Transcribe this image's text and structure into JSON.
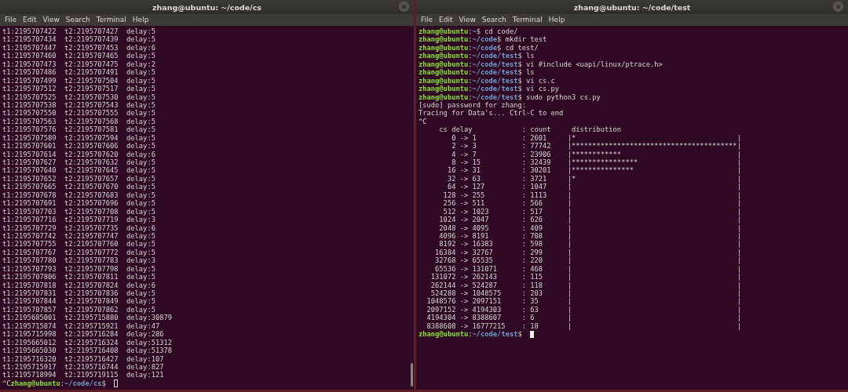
{
  "windows": [
    {
      "title": "zhang@ubuntu: ~/code/cs",
      "focused": false,
      "menu": [
        "File",
        "Edit",
        "View",
        "Search",
        "Terminal",
        "Help"
      ],
      "lines": [
        {
          "kind": "output",
          "text": "t1:2195707422  t2:2195707427  delay:5"
        },
        {
          "kind": "output",
          "text": "t1:2195707434  t2:2195707439  delay:5"
        },
        {
          "kind": "output",
          "text": "t1:2195707447  t2:2195707453  delay:6"
        },
        {
          "kind": "output",
          "text": "t1:2195707460  t2:2195707465  delay:5"
        },
        {
          "kind": "output",
          "text": "t1:2195707473  t2:2195707475  delay:2"
        },
        {
          "kind": "output",
          "text": "t1:2195707486  t2:2195707491  delay:5"
        },
        {
          "kind": "output",
          "text": "t1:2195707499  t2:2195707504  delay:5"
        },
        {
          "kind": "output",
          "text": "t1:2195707512  t2:2195707517  delay:5"
        },
        {
          "kind": "output",
          "text": "t1:2195707525  t2:2195707530  delay:5"
        },
        {
          "kind": "output",
          "text": "t1:2195707538  t2:2195707543  delay:5"
        },
        {
          "kind": "output",
          "text": "t1:2195707550  t2:2195707555  delay:5"
        },
        {
          "kind": "output",
          "text": "t1:2195707563  t2:2195707568  delay:5"
        },
        {
          "kind": "output",
          "text": "t1:2195707576  t2:2195707581  delay:5"
        },
        {
          "kind": "output",
          "text": "t1:2195707589  t2:2195707594  delay:5"
        },
        {
          "kind": "output",
          "text": "t1:2195707601  t2:2195707606  delay:5"
        },
        {
          "kind": "output",
          "text": "t1:2195707614  t2:2195707620  delay:6"
        },
        {
          "kind": "output",
          "text": "t1:2195707627  t2:2195707632  delay:5"
        },
        {
          "kind": "output",
          "text": "t1:2195707640  t2:2195707645  delay:5"
        },
        {
          "kind": "output",
          "text": "t1:2195707652  t2:2195707657  delay:5"
        },
        {
          "kind": "output",
          "text": "t1:2195707665  t2:2195707670  delay:5"
        },
        {
          "kind": "output",
          "text": "t1:2195707678  t2:2195707683  delay:5"
        },
        {
          "kind": "output",
          "text": "t1:2195707691  t2:2195707696  delay:5"
        },
        {
          "kind": "output",
          "text": "t1:2195707703  t2:2195707708  delay:5"
        },
        {
          "kind": "output",
          "text": "t1:2195707716  t2:2195707719  delay:3"
        },
        {
          "kind": "output",
          "text": "t1:2195707729  t2:2195707735  delay:6"
        },
        {
          "kind": "output",
          "text": "t1:2195707742  t2:2195707747  delay:5"
        },
        {
          "kind": "output",
          "text": "t1:2195707755  t2:2195707760  delay:5"
        },
        {
          "kind": "output",
          "text": "t1:2195707767  t2:2195707772  delay:5"
        },
        {
          "kind": "output",
          "text": "t1:2195707780  t2:2195707783  delay:3"
        },
        {
          "kind": "output",
          "text": "t1:2195707793  t2:2195707798  delay:5"
        },
        {
          "kind": "output",
          "text": "t1:2195707806  t2:2195707811  delay:5"
        },
        {
          "kind": "output",
          "text": "t1:2195707818  t2:2195707824  delay:6"
        },
        {
          "kind": "output",
          "text": "t1:2195707831  t2:2195707836  delay:5"
        },
        {
          "kind": "output",
          "text": "t1:2195707844  t2:2195707849  delay:5"
        },
        {
          "kind": "output",
          "text": "t1:2195707857  t2:2195707862  delay:5"
        },
        {
          "kind": "output",
          "text": "t1:2195685001  t2:2195715880  delay:30879"
        },
        {
          "kind": "output",
          "text": "t1:2195715874  t2:2195715921  delay:47"
        },
        {
          "kind": "output",
          "text": "t1:2195715998  t2:2195716284  delay:286"
        },
        {
          "kind": "output",
          "text": "t1:2195665012  t2:2195716324  delay:51312"
        },
        {
          "kind": "output",
          "text": "t1:2195665030  t2:2195716408  delay:51378"
        },
        {
          "kind": "output",
          "text": "t1:2195716320  t2:2195716427  delay:107"
        },
        {
          "kind": "output",
          "text": "t1:2195715917  t2:2195716744  delay:827"
        },
        {
          "kind": "output",
          "text": "t1:2195718994  t2:2195719115  delay:121"
        },
        {
          "kind": "prompt",
          "prefix": "^C",
          "user": "zhang@ubuntu",
          "sep": ":",
          "path": "~/code/cs",
          "rest": "$ ",
          "cursor": true
        }
      ]
    },
    {
      "title": "zhang@ubuntu: ~/code/test",
      "focused": true,
      "menu": [
        "File",
        "Edit",
        "View",
        "Search",
        "Terminal",
        "Help"
      ],
      "lines": [
        {
          "kind": "prompt",
          "user": "zhang@ubuntu",
          "sep": ":",
          "path": "~",
          "rest": "$ cd code/",
          "cursor": false
        },
        {
          "kind": "prompt",
          "user": "zhang@ubuntu",
          "sep": ":",
          "path": "~/code",
          "rest": "$ mkdir test",
          "cursor": false
        },
        {
          "kind": "prompt",
          "user": "zhang@ubuntu",
          "sep": ":",
          "path": "~/code",
          "rest": "$ cd test/",
          "cursor": false
        },
        {
          "kind": "prompt",
          "user": "zhang@ubuntu",
          "sep": ":",
          "path": "~/code/test",
          "rest": "$ ls",
          "cursor": false
        },
        {
          "kind": "prompt",
          "user": "zhang@ubuntu",
          "sep": ":",
          "path": "~/code/test",
          "rest": "$ vi #include <uapi/linux/ptrace.h>",
          "cursor": false
        },
        {
          "kind": "prompt",
          "user": "zhang@ubuntu",
          "sep": ":",
          "path": "~/code/test",
          "rest": "$ ls",
          "cursor": false
        },
        {
          "kind": "prompt",
          "user": "zhang@ubuntu",
          "sep": ":",
          "path": "~/code/test",
          "rest": "$ vi cs.c",
          "cursor": false
        },
        {
          "kind": "prompt",
          "user": "zhang@ubuntu",
          "sep": ":",
          "path": "~/code/test",
          "rest": "$ vi cs.py",
          "cursor": false
        },
        {
          "kind": "prompt",
          "user": "zhang@ubuntu",
          "sep": ":",
          "path": "~/code/test",
          "rest": "$ sudo python3 cs.py",
          "cursor": false
        },
        {
          "kind": "output",
          "text": "[sudo] password for zhang:"
        },
        {
          "kind": "output",
          "text": "Tracing for Data's... Ctrl-C to end"
        },
        {
          "kind": "output",
          "text": "^C"
        },
        {
          "kind": "output",
          "text": "     cs delay            : count     distribution"
        },
        {
          "kind": "output",
          "text": "        0 -> 1           : 2601     |*                                       |"
        },
        {
          "kind": "output",
          "text": "        2 -> 3           : 77742    |****************************************|"
        },
        {
          "kind": "output",
          "text": "        4 -> 7           : 23906    |************                            |"
        },
        {
          "kind": "output",
          "text": "        8 -> 15          : 32439    |****************                        |"
        },
        {
          "kind": "output",
          "text": "       16 -> 31          : 30201    |***************                         |"
        },
        {
          "kind": "output",
          "text": "       32 -> 63          : 3721     |*                                       |"
        },
        {
          "kind": "output",
          "text": "       64 -> 127         : 1047     |                                        |"
        },
        {
          "kind": "output",
          "text": "      128 -> 255         : 1113     |                                        |"
        },
        {
          "kind": "output",
          "text": "      256 -> 511         : 566      |                                        |"
        },
        {
          "kind": "output",
          "text": "      512 -> 1023        : 517      |                                        |"
        },
        {
          "kind": "output",
          "text": "     1024 -> 2047        : 626      |                                        |"
        },
        {
          "kind": "output",
          "text": "     2048 -> 4095        : 409      |                                        |"
        },
        {
          "kind": "output",
          "text": "     4096 -> 8191        : 708      |                                        |"
        },
        {
          "kind": "output",
          "text": "     8192 -> 16383       : 598      |                                        |"
        },
        {
          "kind": "output",
          "text": "    16384 -> 32767       : 299      |                                        |"
        },
        {
          "kind": "output",
          "text": "    32768 -> 65535       : 220      |                                        |"
        },
        {
          "kind": "output",
          "text": "    65536 -> 131071      : 468      |                                        |"
        },
        {
          "kind": "output",
          "text": "   131072 -> 262143      : 115      |                                        |"
        },
        {
          "kind": "output",
          "text": "   262144 -> 524287      : 118      |                                        |"
        },
        {
          "kind": "output",
          "text": "   524288 -> 1048575     : 203      |                                        |"
        },
        {
          "kind": "output",
          "text": "  1048576 -> 2097151     : 35       |                                        |"
        },
        {
          "kind": "output",
          "text": "  2097152 -> 4194303     : 63       |                                        |"
        },
        {
          "kind": "output",
          "text": "  4194304 -> 8388607     : 6        |                                        |"
        },
        {
          "kind": "output",
          "text": "  8388608 -> 16777215    : 18       |                                        |"
        },
        {
          "kind": "prompt",
          "user": "zhang@ubuntu",
          "sep": ":",
          "path": "~/code/test",
          "rest": "$ ",
          "cursor": true
        }
      ]
    }
  ]
}
